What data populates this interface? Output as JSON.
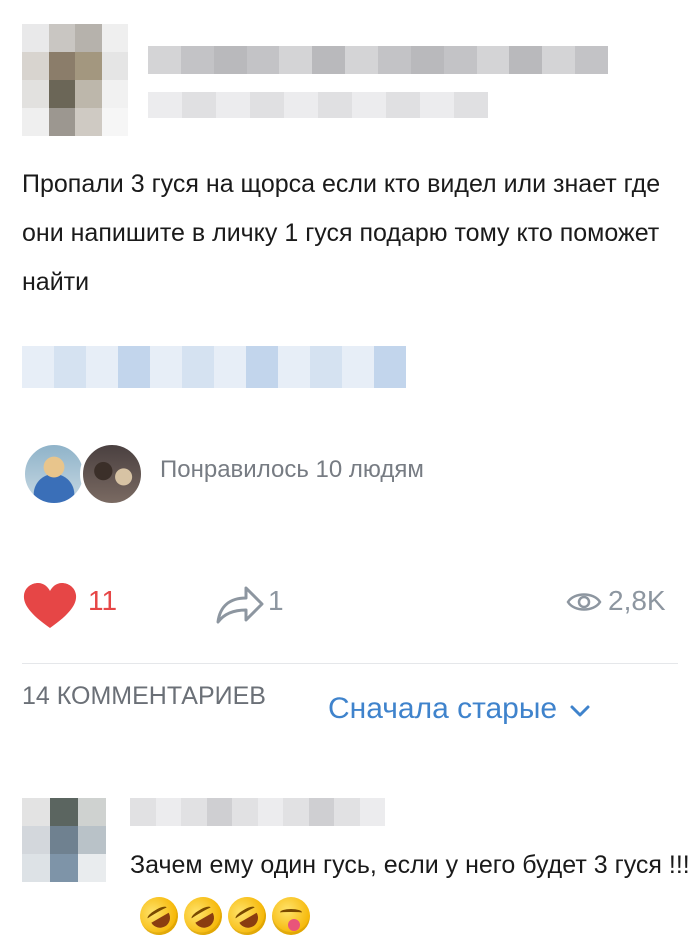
{
  "post": {
    "text": "Пропали 3 гуся на щорса если кто видел или знает где они напишите в личку 1 гуся подарю тому кто поможет найти"
  },
  "likes_summary": {
    "text": "Понравилось 10 людям"
  },
  "actions": {
    "likes": "11",
    "shares": "1",
    "views": "2,8K",
    "accent_like": "#e64646",
    "muted": "#8d96a0"
  },
  "comments": {
    "count_label": "14 КОММЕНТАРИЕВ",
    "sort_label": "Сначала старые",
    "accent": "#3f83cc",
    "items": [
      {
        "text": "Зачем ему один гусь, если у него будет 3 гуся !!!",
        "emojis": [
          "rofl-emoji",
          "rofl-emoji",
          "rofl-emoji",
          "winking-tongue-emoji"
        ]
      }
    ]
  },
  "icons": [
    "heart-icon",
    "share-icon",
    "eye-icon",
    "chevron-down-icon"
  ]
}
